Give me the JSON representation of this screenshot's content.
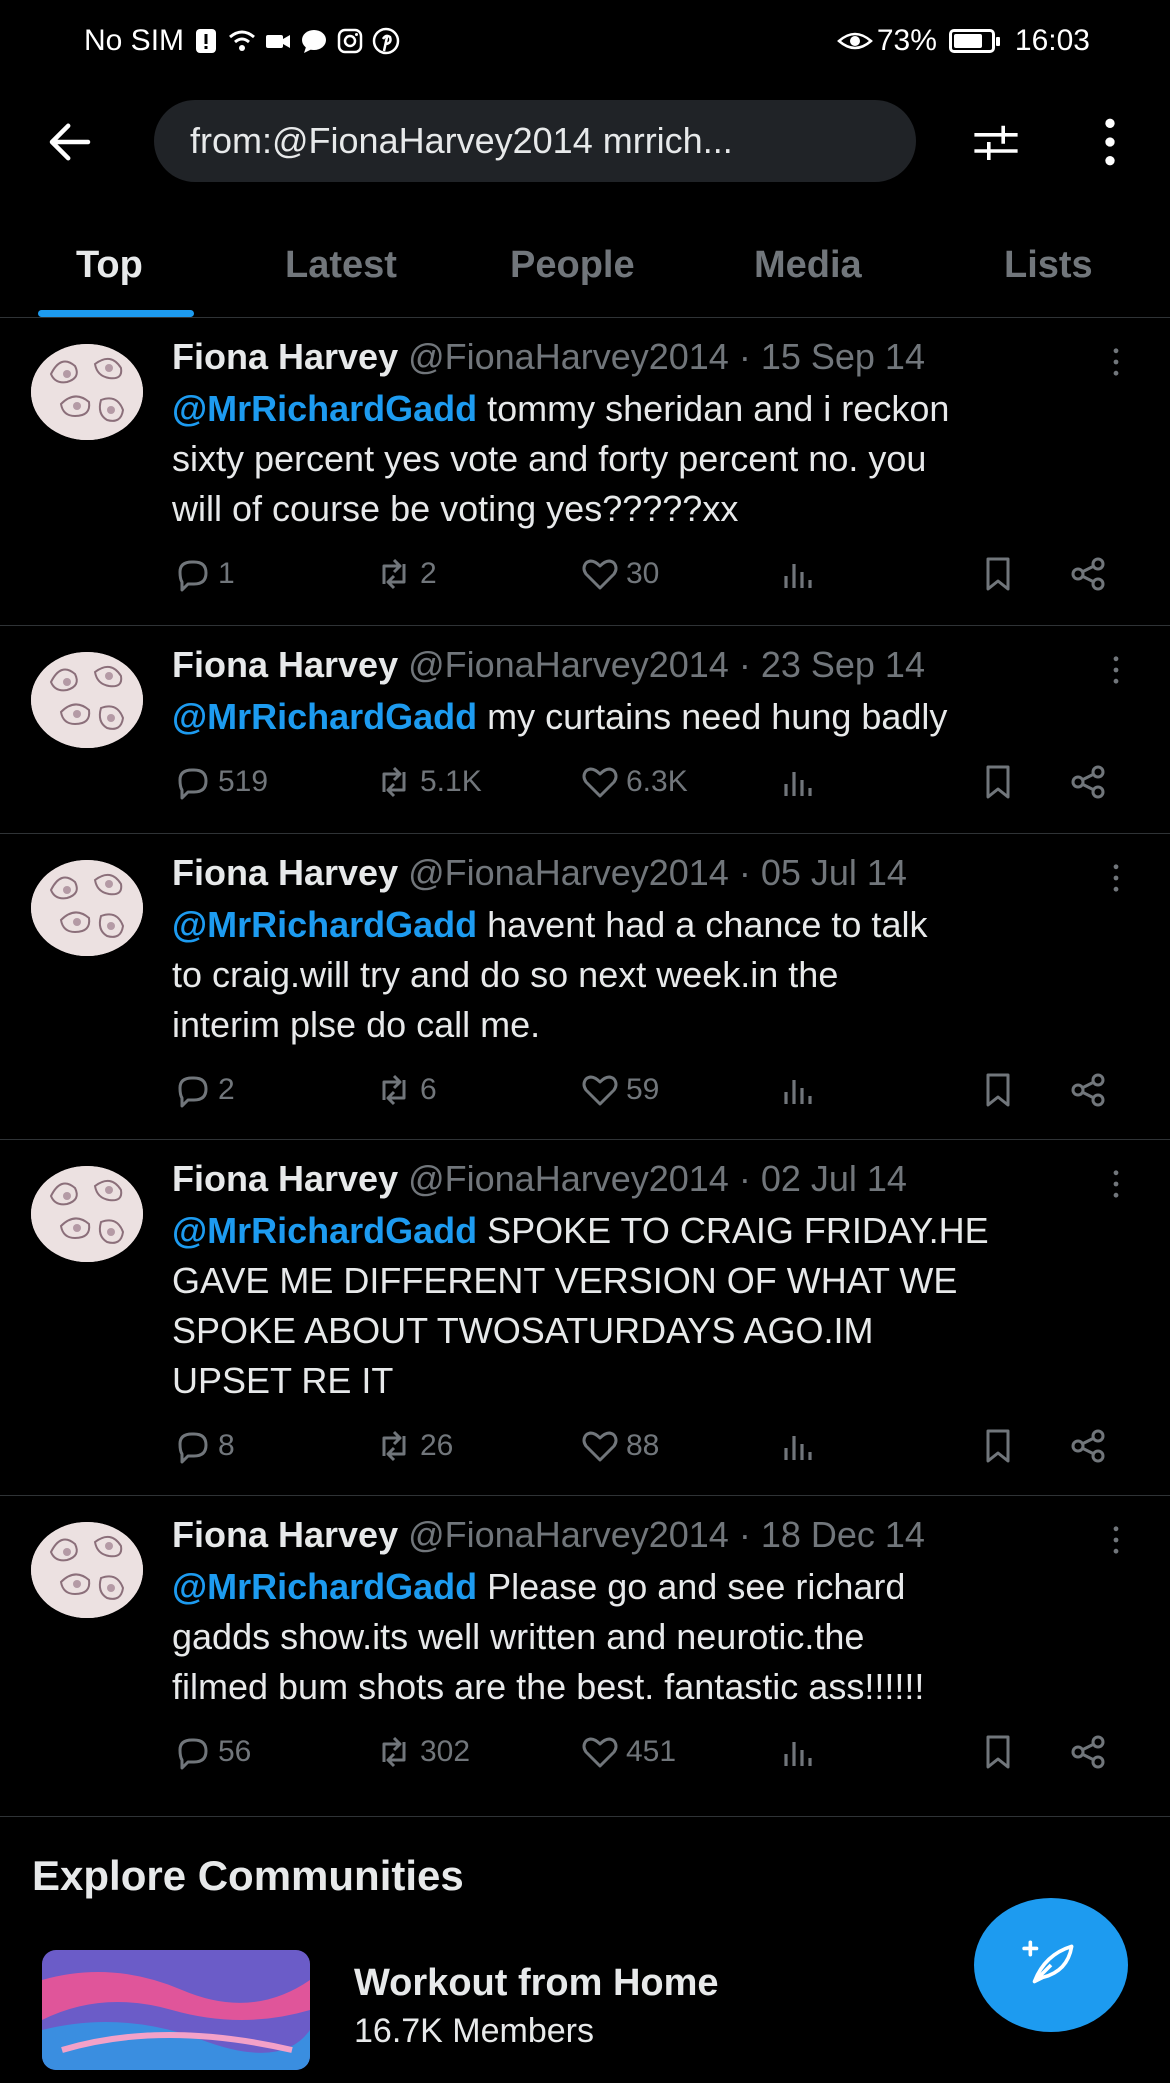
{
  "status_bar": {
    "carrier": "No SIM",
    "battery": "73%",
    "time": "16:03"
  },
  "search": {
    "query": "from:@FionaHarvey2014 mrrich..."
  },
  "tabs": [
    {
      "label": "Top"
    },
    {
      "label": "Latest"
    },
    {
      "label": "People"
    },
    {
      "label": "Media"
    },
    {
      "label": "Lists"
    }
  ],
  "tweets": [
    {
      "name": "Fiona Harvey",
      "handle": "@FionaHarvey2014",
      "date": "· 15 Sep 14",
      "mention": "@MrRichardGadd",
      "lines": [
        " tommy sheridan and i reckon",
        "sixty percent yes vote and forty percent no. you",
        "will of course be voting yes?????xx"
      ],
      "replies": "1",
      "reposts": "2",
      "likes": "30"
    },
    {
      "name": "Fiona Harvey",
      "handle": "@FionaHarvey2014",
      "date": "· 23 Sep 14",
      "mention": "@MrRichardGadd",
      "lines": [
        " my curtains need hung badly"
      ],
      "replies": "519",
      "reposts": "5.1K",
      "likes": "6.3K"
    },
    {
      "name": "Fiona Harvey",
      "handle": "@FionaHarvey2014",
      "date": "· 05 Jul 14",
      "mention": "@MrRichardGadd",
      "lines": [
        " havent had a chance to talk",
        "to craig.will try and do so next week.in the",
        "interim plse do call me."
      ],
      "replies": "2",
      "reposts": "6",
      "likes": "59"
    },
    {
      "name": "Fiona Harvey",
      "handle": "@FionaHarvey2014",
      "date": "· 02 Jul 14",
      "mention": "@MrRichardGadd",
      "lines": [
        " SPOKE TO CRAIG FRIDAY.HE",
        "GAVE ME DIFFERENT VERSION OF WHAT WE",
        "SPOKE ABOUT TWOSATURDAYS AGO.IM",
        "UPSET RE IT"
      ],
      "replies": "8",
      "reposts": "26",
      "likes": "88"
    },
    {
      "name": "Fiona Harvey",
      "handle": "@FionaHarvey2014",
      "date": "· 18 Dec 14",
      "mention": "@MrRichardGadd",
      "lines": [
        " Please go and see richard",
        "gadds show.its well written and neurotic.the",
        "filmed bum shots are the best. fantastic ass!!!!!!"
      ],
      "replies": "56",
      "reposts": "302",
      "likes": "451"
    }
  ],
  "explore": {
    "title": "Explore Communities",
    "community_name": "Workout from Home",
    "community_members": "16.7K Members"
  },
  "colors": {
    "accent": "#1d9bf0",
    "background": "#000000",
    "text": "#e7e9ea",
    "muted": "#71767b"
  }
}
